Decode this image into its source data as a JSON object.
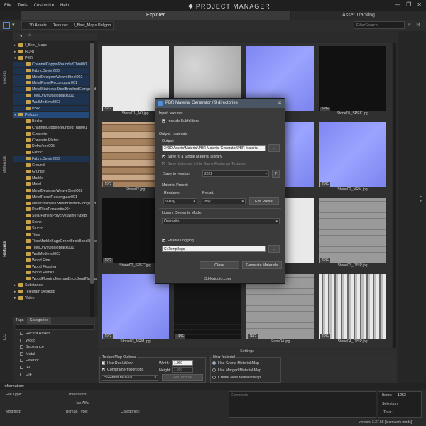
{
  "menu": [
    "File",
    "Tools",
    "Customize",
    "Help"
  ],
  "app_title": "PROJECT MANAGER",
  "window_controls": [
    "—",
    "❐",
    "✕"
  ],
  "tabs": {
    "main": "Explorer",
    "side": "Asset Tracking"
  },
  "breadcrumb": [
    "3D Assets",
    "Textures",
    "!_Best_Maps",
    "Poligon"
  ],
  "filter_placeholder": "FilterSearch",
  "vertical_tabs": [
    "Models",
    "Materials",
    "Textures",
    "IES"
  ],
  "tree": [
    {
      "label": "!_Best_Maps",
      "indent": 0,
      "state": "",
      "arrow": "▸"
    },
    {
      "label": "HDRI",
      "indent": 0,
      "state": "",
      "arrow": "▸"
    },
    {
      "label": "PBR",
      "indent": 0,
      "state": "",
      "arrow": "▾"
    },
    {
      "label": "ChannelCopperRoundedThin001",
      "indent": 1,
      "state": "hl",
      "arrow": ""
    },
    {
      "label": "FabricDenim003",
      "indent": 1,
      "state": "hl",
      "arrow": ""
    },
    {
      "label": "MetalDesignerWeaveSteel002",
      "indent": 1,
      "state": "hl",
      "arrow": ""
    },
    {
      "label": "MetalPanelRectangular001",
      "indent": 1,
      "state": "hl",
      "arrow": ""
    },
    {
      "label": "MetalStainlessSteelBrushedElongated",
      "indent": 1,
      "state": "hl",
      "arrow": ""
    },
    {
      "label": "TilesOnyxOpaloBlack001",
      "indent": 1,
      "state": "hl",
      "arrow": ""
    },
    {
      "label": "WallMedieval003",
      "indent": 1,
      "state": "hl",
      "arrow": ""
    },
    {
      "label": "PBR",
      "indent": 1,
      "state": "hl",
      "arrow": ""
    },
    {
      "label": "Poligon",
      "indent": 0,
      "state": "sel",
      "arrow": "▾"
    },
    {
      "label": "Bricks",
      "indent": 1,
      "state": "",
      "arrow": ""
    },
    {
      "label": "ChannelCopperRoundedThin001",
      "indent": 1,
      "state": "",
      "arrow": ""
    },
    {
      "label": "Concrete",
      "indent": 1,
      "state": "",
      "arrow": ""
    },
    {
      "label": "Concrete Plates",
      "indent": 1,
      "state": "",
      "arrow": ""
    },
    {
      "label": "DefnVpex005",
      "indent": 1,
      "state": "",
      "arrow": ""
    },
    {
      "label": "Fabric",
      "indent": 1,
      "state": "",
      "arrow": ""
    },
    {
      "label": "FabricDenim003",
      "indent": 1,
      "state": "hl",
      "arrow": ""
    },
    {
      "label": "Ground",
      "indent": 1,
      "state": "",
      "arrow": ""
    },
    {
      "label": "Grunge",
      "indent": 1,
      "state": "",
      "arrow": ""
    },
    {
      "label": "Marble",
      "indent": 1,
      "state": "",
      "arrow": ""
    },
    {
      "label": "Metal",
      "indent": 1,
      "state": "",
      "arrow": ""
    },
    {
      "label": "MetalDesignerWeaveSteel002",
      "indent": 1,
      "state": "",
      "arrow": ""
    },
    {
      "label": "MetalPanelRectangular001",
      "indent": 1,
      "state": "",
      "arrow": ""
    },
    {
      "label": "MetalStainlessSteelBrushedElongated",
      "indent": 1,
      "state": "",
      "arrow": ""
    },
    {
      "label": "RoofTilesTerracotta004",
      "indent": 1,
      "state": "",
      "arrow": ""
    },
    {
      "label": "SolarPanelsPolycrystallineTypeB",
      "indent": 1,
      "state": "",
      "arrow": ""
    },
    {
      "label": "Stone",
      "indent": 1,
      "state": "",
      "arrow": ""
    },
    {
      "label": "Stucco",
      "indent": 1,
      "state": "",
      "arrow": ""
    },
    {
      "label": "Tiles",
      "indent": 1,
      "state": "",
      "arrow": ""
    },
    {
      "label": "TilesMarbleSageGreenBrickBondHoned",
      "indent": 1,
      "state": "",
      "arrow": ""
    },
    {
      "label": "TilesOnyxOpaloBlack001",
      "indent": 1,
      "state": "",
      "arrow": ""
    },
    {
      "label": "WallMedieval003",
      "indent": 1,
      "state": "",
      "arrow": ""
    },
    {
      "label": "Wood Fine",
      "indent": 1,
      "state": "",
      "arrow": ""
    },
    {
      "label": "Wood Flooring",
      "indent": 1,
      "state": "",
      "arrow": ""
    },
    {
      "label": "Wood Planks",
      "indent": 1,
      "state": "",
      "arrow": ""
    },
    {
      "label": "WoodFlooringMerbauBrickBondNatural",
      "indent": 1,
      "state": "",
      "arrow": ""
    },
    {
      "label": "Substance",
      "indent": 0,
      "state": "",
      "arrow": "▸"
    },
    {
      "label": "Telegram Desktop",
      "indent": 0,
      "state": "",
      "arrow": "▸"
    },
    {
      "label": "Video",
      "indent": 0,
      "state": "",
      "arrow": "▸"
    }
  ],
  "tags_tabs": [
    "Tags",
    "Categories"
  ],
  "categories": [
    "Recent Assets",
    "Wood",
    "Substance",
    "Metal",
    "Exterior",
    "IFL",
    "GIF"
  ],
  "thumbnails": [
    {
      "caption": "Stone01_AO.jpg",
      "tex": "white",
      "badge": "JPG"
    },
    {
      "caption": "",
      "tex": "gray",
      "badge": "JPG"
    },
    {
      "caption": "",
      "tex": "blue",
      "badge": "JPG"
    },
    {
      "caption": "Stone01_SPEC.jpg",
      "tex": "black",
      "badge": "JPG"
    },
    {
      "caption": "Stone02.jpg",
      "tex": "stone",
      "badge": "JPG"
    },
    {
      "caption": "",
      "tex": "brick",
      "badge": "JPG"
    },
    {
      "caption": "",
      "tex": "blue",
      "badge": "JPG"
    },
    {
      "caption": "Stone02_NRM.jpg",
      "tex": "blue",
      "badge": "JPG"
    },
    {
      "caption": "Stone02_SPEC.jpg",
      "tex": "black",
      "badge": "JPG"
    },
    {
      "caption": "",
      "tex": "noise",
      "badge": "JPG"
    },
    {
      "caption": "",
      "tex": "white",
      "badge": "JPG"
    },
    {
      "caption": "Stone03_DISP.jpg",
      "tex": "graybrick",
      "badge": "JPG"
    },
    {
      "caption": "Stone03_NRM.jpg",
      "tex": "blue",
      "badge": "JPG"
    },
    {
      "caption": "",
      "tex": "darkgrid",
      "badge": "JPG"
    },
    {
      "caption": "Stone04.jpg",
      "tex": "graybrick",
      "badge": "JPG"
    },
    {
      "caption": "Stone04_DISP.jpg",
      "tex": "noise",
      "badge": "JPG"
    }
  ],
  "dialog": {
    "title": "PBR Material Generator / 9 directories",
    "input_heading": "Input: textures",
    "include_subfolders": "Include Subfolders",
    "output_heading": "Output: materials",
    "output_label": "Output:",
    "output_path": "3:\\3D Assets\\Material\\PBR Material Generator\\PBR Material",
    "browse": "...",
    "save_single": "Save to a Single Material Library",
    "save_same": "Save Materials in the Same Folder as Textures",
    "save_version_label": "Save to version:",
    "save_version_value": "2022",
    "preset_heading": "Material Preset:",
    "renderer_label": "Renderer:",
    "renderer_value": "V-Ray",
    "preset_label": "Preset:",
    "preset_value": "vray",
    "edit_preset": "Edit Preset",
    "overwrite_heading": "Library Overwrite Mode:",
    "overwrite_value": "Overwrite",
    "enable_logging": "Enable Logging",
    "log_path": "C:\\Temp\\logs",
    "close": "Close",
    "generate": "Generate Materials"
  },
  "watermark": "3d-kstudio.com",
  "settings_head": "Settings",
  "texturemap": {
    "title": "TextureMap Options",
    "use_real_world": "Use Real-World",
    "constrain": "Constrain Proportions",
    "width_label": "Width:",
    "width_value": "1.000",
    "height_label": "Height:",
    "height_value": "1.000",
    "material_value": "OpenPBR Material",
    "edit_texture": "Edit Texture"
  },
  "new_material": {
    "title": "New Material",
    "options": [
      "Use Scene Material\\Map",
      "Use Merged Material\\Map",
      "Create New Material\\Map"
    ]
  },
  "info": {
    "heading": "Information:",
    "file_type": "File Type:",
    "dimensions": "Dimensions:",
    "has_alfa": "Has Alfa:",
    "modified": "Modified:",
    "bitmap_type": "Bitmap Type:",
    "categories": "Categories:",
    "comments": "Comments",
    "items_label": "Items:",
    "items_value": "1263",
    "selection_label": "Selection:",
    "total_label": "Total:",
    "version": "version: 3.37.58 [teamwork mode]"
  }
}
